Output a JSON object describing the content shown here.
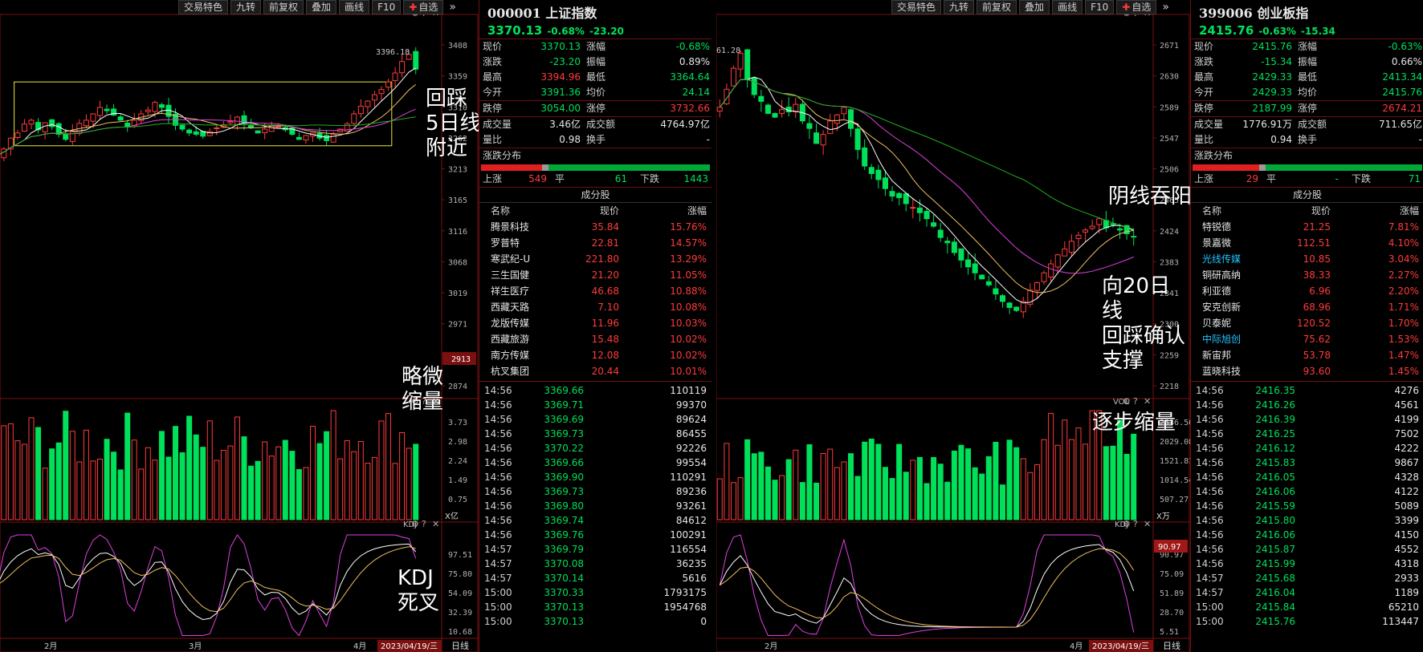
{
  "colors": {
    "up": "#ff3b3b",
    "down": "#00e05a",
    "grid": "#7a1010",
    "box": "#e8e83a",
    "ma5": "#ffffff",
    "ma10": "#f0c060",
    "ma20": "#e040e0",
    "ma60": "#20b020"
  },
  "toolbar": {
    "items": [
      "交易特色",
      "九转",
      "前复权",
      "叠加",
      "画线",
      "F10"
    ],
    "watch": "自选",
    "more_icon": "double-chevron-right-icon"
  },
  "left": {
    "code": "000001",
    "name": "上证指数",
    "price": "3370.13",
    "pct": "-0.68%",
    "chg": "-23.20",
    "quote": [
      {
        "l": "现价",
        "v": "3370.13",
        "vc": "g",
        "l2": "涨幅",
        "v2": "-0.68%",
        "v2c": "g"
      },
      {
        "l": "涨跌",
        "v": "-23.20",
        "vc": "g",
        "l2": "振幅",
        "v2": "0.89%",
        "v2c": "w"
      },
      {
        "l": "最高",
        "v": "3394.96",
        "vc": "r",
        "l2": "最低",
        "v2": "3364.64",
        "v2c": "g"
      },
      {
        "l": "今开",
        "v": "3391.36",
        "vc": "g",
        "l2": "均价",
        "v2": "24.14",
        "v2c": "g"
      },
      {
        "l": "跌停",
        "v": "3054.00",
        "vc": "g",
        "l2": "涨停",
        "v2": "3732.66",
        "v2c": "r"
      },
      {
        "l": "成交量",
        "v": "3.46亿",
        "vc": "w",
        "l2": "成交额",
        "v2": "4764.97亿",
        "v2c": "w"
      },
      {
        "l": "量比",
        "v": "0.98",
        "vc": "w",
        "l2": "换手",
        "v2": "-",
        "v2c": "w"
      }
    ],
    "dist_title": "涨跌分布",
    "up_label": "上涨",
    "up": "549",
    "flat_label": "平",
    "flat": "61",
    "down_label": "下跌",
    "down": "1443",
    "up_ratio": 0.268,
    "cons_title": "成分股",
    "cols": [
      "名称",
      "现价",
      "涨幅"
    ],
    "cons": [
      {
        "n": "腾景科技",
        "p": "35.84",
        "c": "15.76%",
        "nc": "y"
      },
      {
        "n": "罗普特",
        "p": "22.81",
        "c": "14.57%",
        "nc": "y"
      },
      {
        "n": "寒武纪-U",
        "p": "221.80",
        "c": "13.29%",
        "nc": "y"
      },
      {
        "n": "三生国健",
        "p": "21.20",
        "c": "11.05%",
        "nc": "y"
      },
      {
        "n": "祥生医疗",
        "p": "46.68",
        "c": "10.88%",
        "nc": "y"
      },
      {
        "n": "西藏天路",
        "p": "7.10",
        "c": "10.08%",
        "nc": "y"
      },
      {
        "n": "龙版传媒",
        "p": "11.96",
        "c": "10.03%",
        "nc": "y"
      },
      {
        "n": "西藏旅游",
        "p": "15.48",
        "c": "10.02%",
        "nc": "y"
      },
      {
        "n": "南方传媒",
        "p": "12.08",
        "c": "10.02%",
        "nc": "y"
      },
      {
        "n": "杭叉集团",
        "p": "20.44",
        "c": "10.01%",
        "nc": "y"
      }
    ],
    "ticks": [
      [
        "14:56",
        "3369.66",
        "110119"
      ],
      [
        "14:56",
        "3369.71",
        "99370"
      ],
      [
        "14:56",
        "3369.69",
        "89624"
      ],
      [
        "14:56",
        "3369.73",
        "86455"
      ],
      [
        "14:56",
        "3370.22",
        "92226"
      ],
      [
        "14:56",
        "3369.66",
        "99554"
      ],
      [
        "14:56",
        "3369.90",
        "110291"
      ],
      [
        "14:56",
        "3369.73",
        "89236"
      ],
      [
        "14:56",
        "3369.80",
        "93261"
      ],
      [
        "14:56",
        "3369.74",
        "84612"
      ],
      [
        "14:56",
        "3369.76",
        "100291"
      ],
      [
        "14:57",
        "3369.79",
        "116554"
      ],
      [
        "14:57",
        "3370.08",
        "36235"
      ],
      [
        "14:57",
        "3370.14",
        "5616"
      ],
      [
        "15:00",
        "3370.33",
        "1793175"
      ],
      [
        "15:00",
        "3370.13",
        "1954768"
      ],
      [
        "15:00",
        "3370.13",
        "0"
      ]
    ]
  },
  "right": {
    "code": "399006",
    "name": "创业板指",
    "price": "2415.76",
    "pct": "-0.63%",
    "chg": "-15.34",
    "quote": [
      {
        "l": "现价",
        "v": "2415.76",
        "vc": "g",
        "l2": "涨幅",
        "v2": "-0.63%",
        "v2c": "g"
      },
      {
        "l": "涨跌",
        "v": "-15.34",
        "vc": "g",
        "l2": "振幅",
        "v2": "0.66%",
        "v2c": "w"
      },
      {
        "l": "最高",
        "v": "2429.33",
        "vc": "g",
        "l2": "最低",
        "v2": "2413.34",
        "v2c": "g"
      },
      {
        "l": "今开",
        "v": "2429.33",
        "vc": "g",
        "l2": "均价",
        "v2": "2415.76",
        "v2c": "g"
      },
      {
        "l": "跌停",
        "v": "2187.99",
        "vc": "g",
        "l2": "涨停",
        "v2": "2674.21",
        "v2c": "r"
      },
      {
        "l": "成交量",
        "v": "1776.91万",
        "vc": "w",
        "l2": "成交额",
        "v2": "711.65亿",
        "v2c": "w"
      },
      {
        "l": "量比",
        "v": "0.94",
        "vc": "w",
        "l2": "换手",
        "v2": "-",
        "v2c": "w"
      }
    ],
    "dist_title": "涨跌分布",
    "up_label": "上涨",
    "up": "29",
    "flat_label": "平",
    "flat": "-",
    "down_label": "下跌",
    "down": "71",
    "up_ratio": 0.29,
    "cons_title": "成分股",
    "cols": [
      "名称",
      "现价",
      "涨幅"
    ],
    "cons": [
      {
        "n": "特锐德",
        "p": "21.25",
        "c": "7.81%",
        "nc": "y"
      },
      {
        "n": "景嘉微",
        "p": "112.51",
        "c": "4.10%",
        "nc": "y"
      },
      {
        "n": "光线传媒",
        "p": "10.85",
        "c": "3.04%",
        "nc": "c"
      },
      {
        "n": "铜研高纳",
        "p": "38.33",
        "c": "2.27%",
        "nc": "y"
      },
      {
        "n": "利亚德",
        "p": "6.96",
        "c": "2.20%",
        "nc": "y"
      },
      {
        "n": "安克创新",
        "p": "68.96",
        "c": "1.71%",
        "nc": "y"
      },
      {
        "n": "贝泰妮",
        "p": "120.52",
        "c": "1.70%",
        "nc": "y"
      },
      {
        "n": "中际旭创",
        "p": "75.62",
        "c": "1.53%",
        "nc": "c"
      },
      {
        "n": "新宙邦",
        "p": "53.78",
        "c": "1.47%",
        "nc": "y"
      },
      {
        "n": "蓝晓科技",
        "p": "93.60",
        "c": "1.45%",
        "nc": "y"
      }
    ],
    "ticks": [
      [
        "14:56",
        "2416.35",
        "4276"
      ],
      [
        "14:56",
        "2416.26",
        "4561"
      ],
      [
        "14:56",
        "2416.39",
        "4199"
      ],
      [
        "14:56",
        "2416.25",
        "7502"
      ],
      [
        "14:56",
        "2416.12",
        "4222"
      ],
      [
        "14:56",
        "2415.83",
        "9867"
      ],
      [
        "14:56",
        "2416.05",
        "4328"
      ],
      [
        "14:56",
        "2416.06",
        "4122"
      ],
      [
        "14:56",
        "2415.59",
        "5089"
      ],
      [
        "14:56",
        "2415.80",
        "3399"
      ],
      [
        "14:56",
        "2416.06",
        "4150"
      ],
      [
        "14:56",
        "2415.87",
        "4552"
      ],
      [
        "14:56",
        "2415.99",
        "4318"
      ],
      [
        "14:57",
        "2415.68",
        "2933"
      ],
      [
        "14:57",
        "2416.04",
        "1189"
      ],
      [
        "15:00",
        "2415.84",
        "65210"
      ],
      [
        "15:00",
        "2415.76",
        "113447"
      ]
    ]
  },
  "left_chart": {
    "price_ticks": [
      "3408",
      "3359",
      "3310",
      "3262",
      "3213",
      "3165",
      "3116",
      "3068",
      "3019",
      "2971",
      "2922",
      "2874"
    ],
    "price_axis_min": 2874,
    "price_axis_max": 3408,
    "hi_label": "3396.18",
    "cursor_label": "2913",
    "vol_ticks": [
      "3.73",
      "2.98",
      "2.24",
      "1.49",
      "0.75"
    ],
    "vol_unit": "X亿",
    "kdj_label": "KDJ",
    "kdj_ticks": [
      "97.51",
      "75.80",
      "54.09",
      "32.39",
      "10.68"
    ],
    "months": [
      "2月",
      "3月",
      "4月"
    ],
    "date": "2023/04/19/三",
    "period": "日线",
    "box": {
      "lo": 3250,
      "hi": 3350,
      "from": 3,
      "to": 58
    }
  },
  "right_chart": {
    "price_ticks": [
      "2671",
      "2630",
      "2589",
      "2547",
      "2506",
      "2465",
      "2424",
      "2383",
      "2341",
      "2300",
      "2259",
      "2218"
    ],
    "price_axis_min": 2218,
    "price_axis_max": 2671,
    "hi_label": "61.28",
    "cursor_label": "",
    "vol_label": "VOL",
    "vol_ticks": [
      "2536.56",
      "2029.08",
      "1521.81",
      "1014.54",
      "507.27"
    ],
    "vol_unit": "X万",
    "kdj_label": "KDJ",
    "kdj_ticks": [
      "90.97",
      "75.09",
      "51.89",
      "28.70",
      "5.51"
    ],
    "kdj_cursor": "90.97",
    "months": [
      "2月",
      "4月"
    ],
    "date": "2023/04/19/三",
    "period": "日线"
  },
  "annotations": {
    "l1": "回踩\n5日线\n附近",
    "l2": "略微\n缩量",
    "l3": "KDJ\n死叉",
    "r1": "阴线吞阳线",
    "r2": "向20日线\n回踩确认\n支撑",
    "r3": "逐步缩量"
  },
  "chart_data": [
    {
      "type": "candlestick",
      "name": "上证指数 日线",
      "series_ma": [
        "MA5",
        "MA10",
        "MA20",
        "MA60"
      ],
      "close": [
        3235,
        3245,
        3262,
        3270,
        3284,
        3290,
        3275,
        3286,
        3280,
        3268,
        3260,
        3272,
        3285,
        3290,
        3300,
        3310,
        3305,
        3298,
        3290,
        3280,
        3290,
        3300,
        3306,
        3318,
        3310,
        3296,
        3282,
        3276,
        3270,
        3268,
        3265,
        3272,
        3278,
        3283,
        3288,
        3295,
        3285,
        3278,
        3270,
        3276,
        3282,
        3280,
        3275,
        3268,
        3260,
        3266,
        3270,
        3262,
        3258,
        3268,
        3276,
        3284,
        3300,
        3312,
        3320,
        3330,
        3338,
        3350,
        3364,
        3382,
        3393,
        3370
      ]
    },
    {
      "type": "candlestick",
      "name": "创业板指 日线",
      "close": [
        2588,
        2612,
        2640,
        2660,
        2625,
        2605,
        2596,
        2580,
        2575,
        2585,
        2582,
        2592,
        2570,
        2560,
        2540,
        2552,
        2570,
        2578,
        2588,
        2560,
        2532,
        2510,
        2500,
        2492,
        2480,
        2470,
        2468,
        2460,
        2455,
        2448,
        2440,
        2430,
        2415,
        2408,
        2395,
        2385,
        2376,
        2368,
        2360,
        2352,
        2340,
        2330,
        2322,
        2318,
        2330,
        2345,
        2355,
        2368,
        2380,
        2392,
        2400,
        2410,
        2418,
        2425,
        2430,
        2440,
        2428,
        2432,
        2425,
        2420,
        2416
      ]
    }
  ]
}
